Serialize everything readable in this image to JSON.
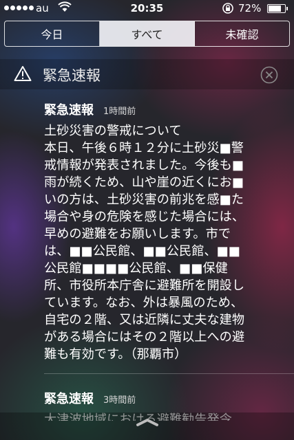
{
  "status_bar": {
    "carrier": "au",
    "time": "20:35",
    "battery_percent": "72%",
    "battery_level": 0.72,
    "icons": [
      "signal-dots",
      "wifi-icon",
      "rotation-lock-icon",
      "battery-icon"
    ]
  },
  "tabs": [
    {
      "label": "今日",
      "selected": false
    },
    {
      "label": "すべて",
      "selected": true
    },
    {
      "label": "未確認",
      "selected": false
    }
  ],
  "header": {
    "title": "緊急速報",
    "icons": [
      "warning-icon",
      "close-icon"
    ]
  },
  "notifications": [
    {
      "source": "緊急速報",
      "time": "1時間前",
      "body": "土砂災害の警戒について\n本日、午後６時１２分に土砂災■警\n戒情報が発表されました。今後も■\n雨が続くため、山や崖の近くにお■\nいの方は、土砂災害の前兆を感■た\n場合や身の危険を感じた場合には、\n早めの避難をお願いします。市で\nは、■■公民館、■■公民館、■■\n公民館■■■■公民館、■■保健\n所、市役所本庁舎に避難所を開設し\nています。なお、外は暴風のため、\n自宅の２階、又は近隣に丈夫な建物\nがある場合にはその２階以上への避\n難も有効です。（那覇市）"
    },
    {
      "source": "緊急速報",
      "time": "3時間前",
      "preview": "大津波地域における避難勧告発令"
    }
  ],
  "grabber": {
    "icon": "chevron-up-icon"
  },
  "colors": {
    "selected_tab_bg": "#f2f2f6",
    "header_text": "#ececec"
  }
}
